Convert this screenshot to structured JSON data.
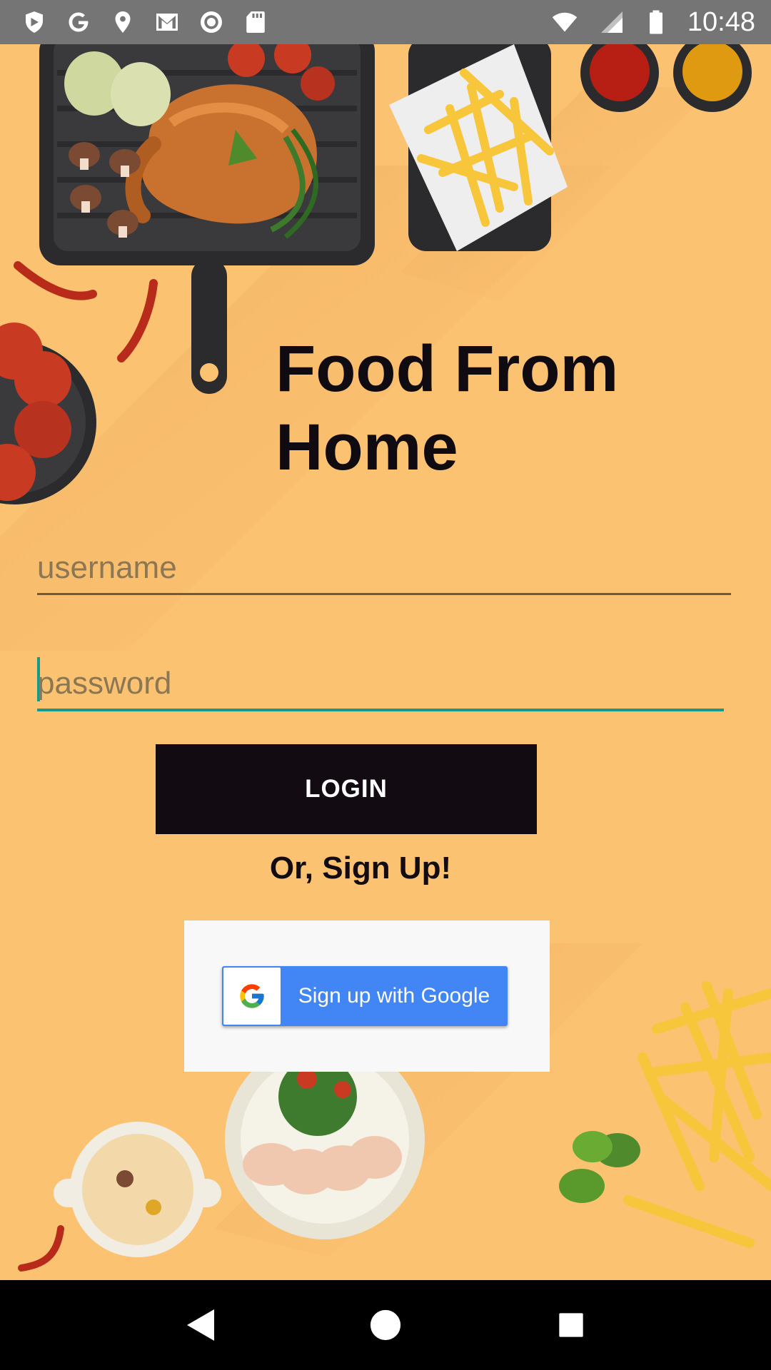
{
  "status_bar": {
    "time": "10:48",
    "left_icons": [
      "shield-icon",
      "google-g-icon",
      "location-icon",
      "gmail-icon",
      "record-icon",
      "sd-card-icon"
    ],
    "right_icons": [
      "wifi-icon",
      "signal-icon",
      "battery-icon"
    ]
  },
  "app": {
    "title": "Food From Home",
    "username_placeholder": "username",
    "password_placeholder": "password",
    "login_label": "LOGIN",
    "signup_text": "Or, Sign Up!",
    "google_signup_label": "Sign up with Google"
  },
  "colors": {
    "background": "#fbc271",
    "login_button": "#120c12",
    "google_blue": "#4285f4",
    "focus_accent": "#17998a"
  },
  "nav_bar": {
    "buttons": [
      "back-icon",
      "home-icon",
      "recents-icon"
    ]
  }
}
